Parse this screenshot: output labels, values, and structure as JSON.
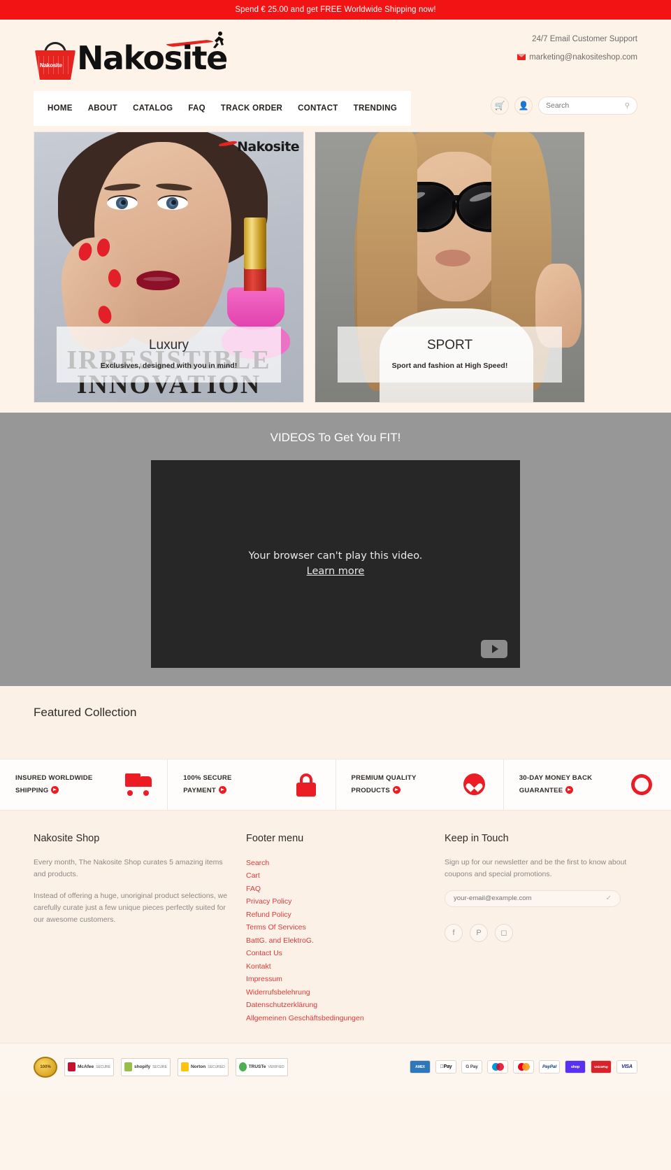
{
  "promo": {
    "text": "Spend € 25.00 and get FREE Worldwide Shipping now!"
  },
  "header": {
    "logo_text": "Nakosite",
    "logo_basket_label": "Nakosite",
    "support_line": "24/7 Email Customer Support",
    "email": "marketing@nakositeshop.com"
  },
  "nav": {
    "items": [
      {
        "label": "HOME"
      },
      {
        "label": "ABOUT"
      },
      {
        "label": "CATALOG"
      },
      {
        "label": "FAQ"
      },
      {
        "label": "TRACK ORDER"
      },
      {
        "label": "CONTACT"
      },
      {
        "label": "TRENDING"
      }
    ],
    "cart_icon": "cart-icon",
    "account_icon": "user-icon",
    "search_placeholder": "Search",
    "search_value": ""
  },
  "banners": [
    {
      "title": "Luxury",
      "subtitle": "Exclusives, designed with you in mind!",
      "watermark": "Nakosite",
      "ribbon_line1": "IRRESISTIBLE",
      "ribbon_line2": "INNOVATION"
    },
    {
      "title": "SPORT",
      "subtitle": "Sport and fashion at High Speed!"
    }
  ],
  "video": {
    "title": "VIDEOS To Get You FIT!",
    "error_line": "Your browser can't play this video.",
    "error_link": "Learn more"
  },
  "featured": {
    "title": "Featured Collection"
  },
  "benefits": [
    {
      "line1": "INSURED WORLDWIDE",
      "line2": "SHIPPING",
      "icon": "truck-icon"
    },
    {
      "line1": "100% SECURE",
      "line2": "PAYMENT",
      "icon": "lock-icon"
    },
    {
      "line1": "PREMIUM QUALITY",
      "line2": "PRODUCTS",
      "icon": "heart-icon"
    },
    {
      "line1": "30-DAY MONEY BACK",
      "line2": "GUARANTEE",
      "icon": "refresh-icon"
    }
  ],
  "footer": {
    "about": {
      "title": "Nakosite Shop",
      "p1": "Every month, The Nakosite Shop curates 5 amazing items and products.",
      "p2": "Instead of offering a huge, unoriginal product selections, we carefully curate just a few unique pieces perfectly suited for our awesome customers."
    },
    "menu": {
      "title": "Footer menu",
      "links": [
        "Search",
        "Cart",
        "FAQ",
        "Privacy Policy",
        "Refund Policy",
        "Terms Of Services",
        "BattG. and ElektroG.",
        "Contact Us",
        "Kontakt",
        "Impressum",
        "Widerrufsbelehrung",
        "Datenschutzerklärung",
        "Allgemeinen Geschäftsbedingungen"
      ]
    },
    "keep_in_touch": {
      "title": "Keep in Touch",
      "text": "Sign up for our newsletter and be the first to know about coupons and special promotions.",
      "email_placeholder": "your-email@example.com",
      "email_value": "",
      "socials": [
        {
          "name": "facebook-icon",
          "glyph": "f"
        },
        {
          "name": "pinterest-icon",
          "glyph": "P"
        },
        {
          "name": "instagram-icon",
          "glyph": "◻"
        }
      ]
    }
  },
  "bottom": {
    "seals": [
      {
        "name": "money-back-guarantee-seal",
        "label": "100% SATISFACTION"
      },
      {
        "name": "mcafee-secure-seal",
        "label": "McAfee",
        "sub": "SECURE"
      },
      {
        "name": "shopify-secure-seal",
        "label": "shopify",
        "sub": "SECURE"
      },
      {
        "name": "norton-secured-seal",
        "label": "Norton",
        "sub": "SECURED"
      },
      {
        "name": "truste-verified-seal",
        "label": "TRUSTe",
        "sub": "VERIFIED"
      }
    ],
    "payments": [
      {
        "name": "amex",
        "label": "AMEX"
      },
      {
        "name": "apple-pay",
        "label": "Pay"
      },
      {
        "name": "google-pay",
        "label": "G Pay"
      },
      {
        "name": "maestro",
        "label": ""
      },
      {
        "name": "mastercard",
        "label": ""
      },
      {
        "name": "paypal",
        "label": "PayPal"
      },
      {
        "name": "shop-pay",
        "label": "shop"
      },
      {
        "name": "unionpay",
        "label": "UnionPay"
      },
      {
        "name": "visa",
        "label": "VISA"
      }
    ]
  },
  "colors": {
    "accent": "#ec1c24",
    "cream": "#fdf3e9",
    "link": "#e03a3a"
  }
}
